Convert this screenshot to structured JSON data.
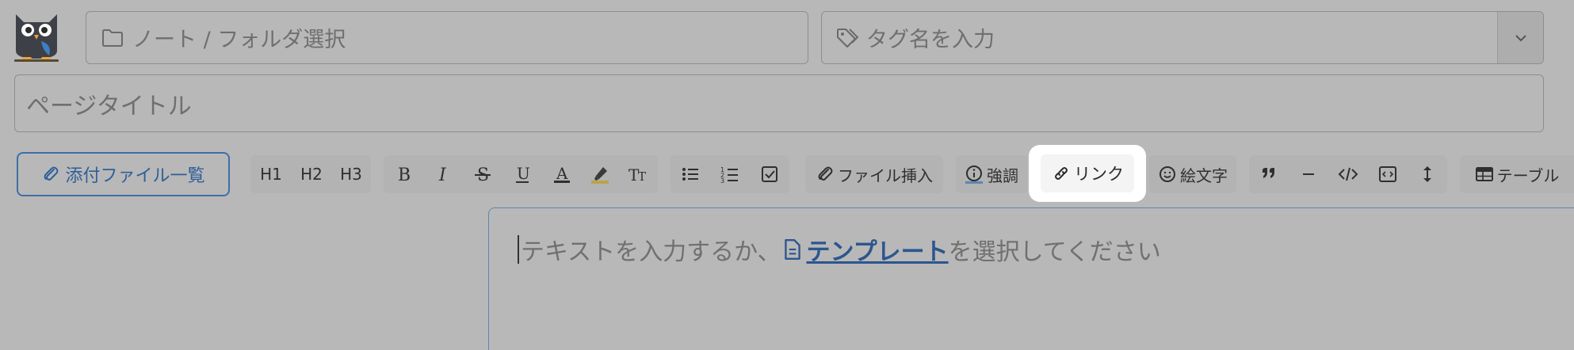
{
  "header": {
    "folder_placeholder": "ノート / フォルダ選択",
    "tag_placeholder": "タグ名を入力",
    "title_placeholder": "ページタイトル"
  },
  "toolbar": {
    "attach_label": "添付ファイル一覧",
    "h1": "H1",
    "h2": "H2",
    "h3": "H3",
    "file_insert": "ファイル挿入",
    "emphasis": "強調",
    "link": "リンク",
    "emoji": "絵文字",
    "table": "テーブル"
  },
  "editor": {
    "placeholder_before": "テキストを入力するか、",
    "template_link": "テンプレート",
    "placeholder_after": "を選択してください"
  },
  "colors": {
    "accent": "#3f6fa6",
    "background": "#b8b8b8"
  },
  "icons": [
    "owl-logo",
    "folder-icon",
    "tag-icon",
    "chevron-down-icon",
    "paperclip-icon",
    "bold-icon",
    "italic-icon",
    "strikethrough-icon",
    "underline-icon",
    "text-color-icon",
    "highlighter-icon",
    "clear-format-icon",
    "bullet-list-icon",
    "numbered-list-icon",
    "checkbox-icon",
    "info-icon",
    "link-icon",
    "smiley-icon",
    "quote-icon",
    "horizontal-rule-icon",
    "code-icon",
    "code-block-icon",
    "vertical-arrows-icon",
    "table-icon",
    "document-icon"
  ]
}
